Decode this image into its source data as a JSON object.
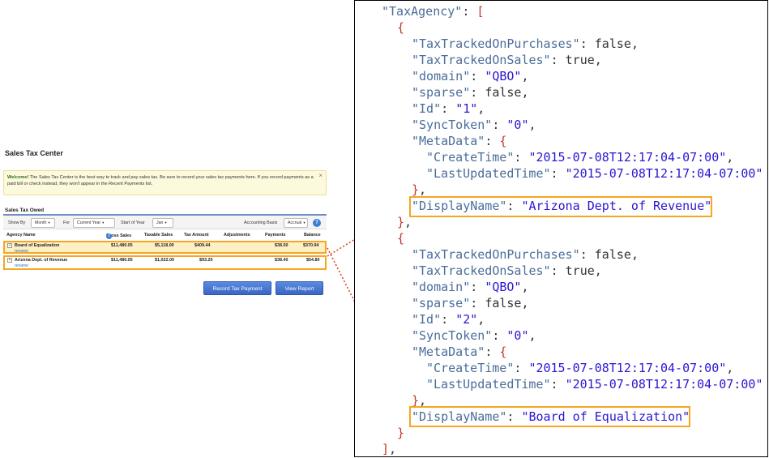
{
  "sales_tax_center": {
    "title": "Sales Tax Center",
    "welcome_bold": "Welcome!",
    "welcome_text": " The Sales Tax Center is the best way to track and pay sales tax. Be sure to record your sales tax payments here. If you record payments as a paid bill or check instead, they won't appear in the Recent Payments list.",
    "close_glyph": "×",
    "owed_title": "Sales Tax Owed",
    "filters": {
      "show_by_label": "Show By",
      "show_by_value": "Month",
      "for_label": "For",
      "for_value": "Current Year",
      "start_label": "Start of Year",
      "start_value": "Jan",
      "basis_label": "Accounting Basis",
      "basis_value": "Accrual",
      "caret": "▾",
      "help_glyph": "?"
    },
    "columns": {
      "agency": "Agency Name",
      "gross": "Gross Sales",
      "taxable": "Taxable Sales",
      "tax": "Tax Amount",
      "adjustments": "Adjustments",
      "payments": "Payments",
      "balance": "Balance",
      "info_glyph": "i"
    },
    "rows": [
      {
        "name": "Board of Equalization",
        "link": "rename",
        "gross": "$11,480.05",
        "taxable": "$5,118.00",
        "tax": "$409.44",
        "adjustments": "",
        "payments": "$38.50",
        "balance": "$370.94",
        "expand": "+"
      },
      {
        "name": "Arizona Dept. of Revenue",
        "link": "rename",
        "gross": "$11,480.05",
        "taxable": "$1,022.00",
        "tax": "$93.20",
        "adjustments": "",
        "payments": "$38.40",
        "balance": "$54.80",
        "expand": "+"
      }
    ],
    "buttons": {
      "record": "Record Tax Payment",
      "report": "View Report"
    }
  },
  "code": {
    "root_key": "\"TaxAgency\"",
    "agencies": [
      {
        "TaxTrackedOnPurchases": "false",
        "TaxTrackedOnSales": "true",
        "domain": "\"QBO\"",
        "sparse": "false",
        "Id": "\"1\"",
        "SyncToken": "\"0\"",
        "CreateTime": "\"2015-07-08T12:17:04-07:00\"",
        "LastUpdatedTime": "\"2015-07-08T12:17:04-07:00\"",
        "DisplayName": "\"Arizona Dept. of Revenue\""
      },
      {
        "TaxTrackedOnPurchases": "false",
        "TaxTrackedOnSales": "true",
        "domain": "\"QBO\"",
        "sparse": "false",
        "Id": "\"2\"",
        "SyncToken": "\"0\"",
        "CreateTime": "\"2015-07-08T12:17:04-07:00\"",
        "LastUpdatedTime": "\"2015-07-08T12:17:04-07:00\"",
        "DisplayName": "\"Board of Equalization\""
      }
    ],
    "keys": {
      "purchases": "\"TaxTrackedOnPurchases\"",
      "sales": "\"TaxTrackedOnSales\"",
      "domain": "\"domain\"",
      "sparse": "\"sparse\"",
      "id": "\"Id\"",
      "sync": "\"SyncToken\"",
      "meta": "\"MetaData\"",
      "create": "\"CreateTime\"",
      "updated": "\"LastUpdatedTime\"",
      "display": "\"DisplayName\""
    }
  },
  "colors": {
    "highlight": "#f5a623",
    "connector": "#e0452a",
    "button": "#3a66c4"
  }
}
